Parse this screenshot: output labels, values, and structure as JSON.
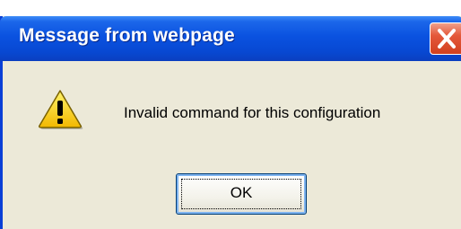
{
  "dialog": {
    "title": "Message from webpage",
    "message": "Invalid command for this configuration",
    "ok_label": "OK",
    "icon": "warning-icon",
    "close_icon": "close-icon"
  },
  "colors": {
    "titlebar": "#0a52e0",
    "dialog_background": "#ece9d8",
    "close_button": "#d2401f",
    "warning_yellow": "#ffd800"
  }
}
